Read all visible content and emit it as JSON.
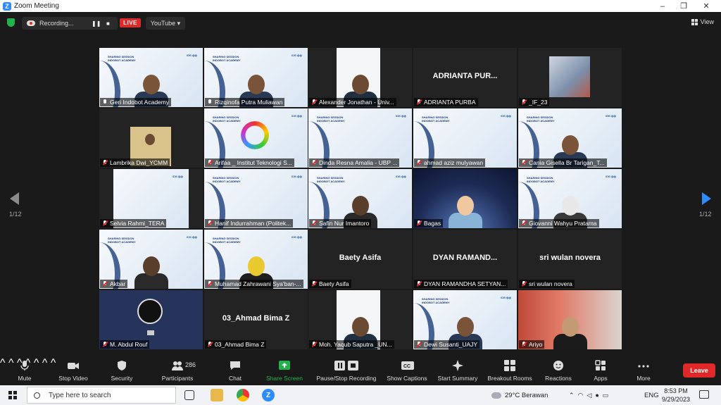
{
  "window": {
    "title": "Zoom Meeting",
    "controls": [
      "–",
      "❐",
      "✕"
    ]
  },
  "topbar": {
    "recording_label": "Recording...",
    "pause_glyph": "❚❚",
    "stop_glyph": "■",
    "live_label": "LIVE",
    "stream_label": "YouTube ▾",
    "view_label": "View"
  },
  "pagination": {
    "left": "1/12",
    "right": "1/12"
  },
  "participants": [
    {
      "name": "Geri Indobot Academy",
      "mic": "on",
      "type": "slide-cam",
      "active": true
    },
    {
      "name": "Rizqinofa Putra Muliawan",
      "mic": "on",
      "type": "slide-cam"
    },
    {
      "name": "Alexander Jonathan - Univ...",
      "mic": "off",
      "type": "white-cam"
    },
    {
      "name": "ADRIANTA PURBA",
      "mic": "off",
      "type": "name",
      "display": "ADRIANTA PUR..."
    },
    {
      "name": "_IF_23",
      "mic": "off",
      "type": "photo"
    },
    {
      "name": "Lambrika Dwi_YCMM",
      "mic": "off",
      "type": "small-cam"
    },
    {
      "name": "Arifaa _ Institut Teknologi S...",
      "mic": "off",
      "type": "slide-ring"
    },
    {
      "name": "Dinda Resna Amalia - UBP ...",
      "mic": "off",
      "type": "slide"
    },
    {
      "name": "ahmad aziz mulyawan",
      "mic": "off",
      "type": "slide"
    },
    {
      "name": "Cania Gisella Br Tarigan_T...",
      "mic": "off",
      "type": "slide-cam"
    },
    {
      "name": "Selvia Rahmi_TERA",
      "mic": "off",
      "type": "slide-narrow"
    },
    {
      "name": "Hanif Indurrahman (Politek...",
      "mic": "off",
      "type": "slide"
    },
    {
      "name": "Safin Nur Imantoro",
      "mic": "off",
      "type": "slide-avatar"
    },
    {
      "name": "Bagas",
      "mic": "off",
      "type": "avatar-space"
    },
    {
      "name": "Giovanni Wahyu Pratama",
      "mic": "off",
      "type": "slide-avatar-white"
    },
    {
      "name": "Akbar",
      "mic": "off",
      "type": "slide-avatar"
    },
    {
      "name": "Muhamad Zahrawani Sya'ban-...",
      "mic": "off",
      "type": "slide-avatar-yellow"
    },
    {
      "name": "Baety Asifa",
      "mic": "off",
      "type": "name",
      "display": "Baety Asifa"
    },
    {
      "name": "DYAN RAMANDHA SETYAN...",
      "mic": "off",
      "type": "name",
      "display": "DYAN RAMAND..."
    },
    {
      "name": "sri wulan novera",
      "mic": "off",
      "type": "name",
      "display": "sri wulan novera"
    },
    {
      "name": "M. Abdul Rouf",
      "mic": "off",
      "type": "obs"
    },
    {
      "name": "03_Ahmad Bima Z",
      "mic": "off",
      "type": "name",
      "display": "03_Ahmad Bima Z"
    },
    {
      "name": "Moh. Yaqub Saputra _UN...",
      "mic": "off",
      "type": "white-cam"
    },
    {
      "name": "Dewi Susanti_UAJY",
      "mic": "off",
      "type": "slide-cam"
    },
    {
      "name": "Ariyo",
      "mic": "off",
      "type": "room-cam"
    }
  ],
  "toolbar": {
    "mute": "Mute",
    "stop_video": "Stop Video",
    "security": "Security",
    "participants": "Participants",
    "participants_count": "286",
    "chat": "Chat",
    "share_screen": "Share Screen",
    "pause_stop_recording": "Pause/Stop Recording",
    "show_captions": "Show Captions",
    "start_summary": "Start Summary",
    "breakout_rooms": "Breakout Rooms",
    "reactions": "Reactions",
    "apps": "Apps",
    "more": "More",
    "leave": "Leave"
  },
  "taskbar": {
    "search_placeholder": "Type here to search",
    "weather": "29°C  Berawan",
    "language": "ENG",
    "time": "8:53 PM",
    "date": "9/29/2023"
  },
  "colors": {
    "accent": "#2d8cff",
    "leave": "#e02828",
    "active_speaker": "#d7e16b",
    "share": "#23b14d"
  }
}
